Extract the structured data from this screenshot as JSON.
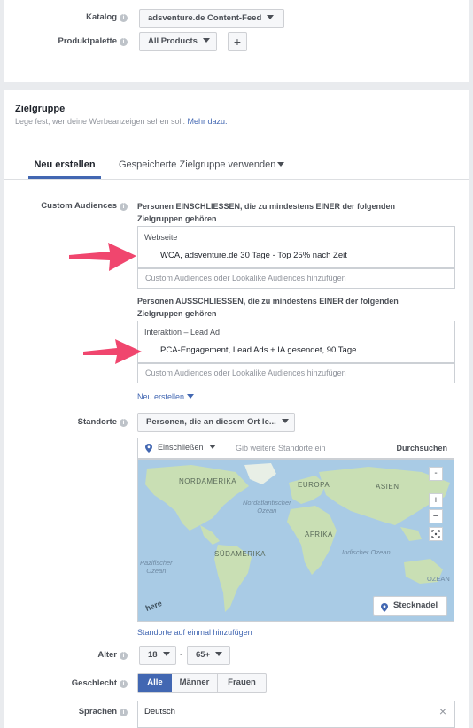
{
  "top": {
    "katalog_label": "Katalog",
    "katalog_value": "adsventure.de Content-Feed",
    "produkt_label": "Produktpalette",
    "produkt_value": "All Products",
    "add_symbol": "+"
  },
  "zielgruppe": {
    "title": "Zielgruppe",
    "subtitle": "Lege fest, wer deine Werbeanzeigen sehen soll.",
    "more_link": "Mehr dazu."
  },
  "tabs": [
    {
      "label": "Neu erstellen",
      "active": true
    },
    {
      "label": "Gespeicherte Zielgruppe verwenden",
      "active": false
    }
  ],
  "custom_audiences": {
    "label": "Custom Audiences",
    "include_text": "Personen EINSCHLIESSEN, die zu mindestens EINER der folgenden Zielgruppen gehören",
    "include_group": "Webseite",
    "include_item": "WCA, adsventure.de 30 Tage - Top 25% nach Zeit",
    "include_placeholder": "Custom Audiences oder Lookalike Audiences hinzufügen",
    "exclude_text": "Personen AUSSCHLIESSEN, die zu mindestens EINER der folgenden Zielgruppen gehören",
    "exclude_group": "Interaktion – Lead Ad",
    "exclude_item": "PCA-Engagement, Lead Ads + IA gesendet, 90 Tage",
    "exclude_placeholder": "Custom Audiences oder Lookalike Audiences hinzufügen",
    "new_link": "Neu erstellen"
  },
  "standorte": {
    "label": "Standorte",
    "dropdown": "Personen, die an diesem Ort le...",
    "include_select": "Einschließen",
    "search_placeholder": "Gib weitere Standorte ein",
    "search_button": "Durchsuchen",
    "map_labels": {
      "na": "NORDAMERIKA",
      "eu": "EUROPA",
      "as": "ASIEN",
      "north_atlantic_1": "Nordatlantischer",
      "north_atlantic_2": "Ozean",
      "af": "AFRIKA",
      "sa": "SÜDAMERIKA",
      "pacific_1": "Pazifischer",
      "pacific_2": "Ozean",
      "indian_1": "Indischer Ozean",
      "oz": "OZEAN",
      "here": "here"
    },
    "pin_button": "Stecknadel",
    "bulk_link": "Standorte auf einmal hinzufügen",
    "map_minus": "-",
    "map_plus": "+",
    "map_minus2": "−"
  },
  "alter": {
    "label": "Alter",
    "min": "18",
    "sep": "-",
    "max": "65+"
  },
  "geschlecht": {
    "label": "Geschlecht",
    "options": [
      "Alle",
      "Männer",
      "Frauen"
    ],
    "selected": "Alle"
  },
  "sprachen": {
    "label": "Sprachen",
    "value": "Deutsch",
    "clear": "×"
  },
  "colors": {
    "accent": "#4267b2",
    "arrow": "#f0466e",
    "map_water": "#a9cbe5",
    "map_land": "#c9dfb4"
  }
}
